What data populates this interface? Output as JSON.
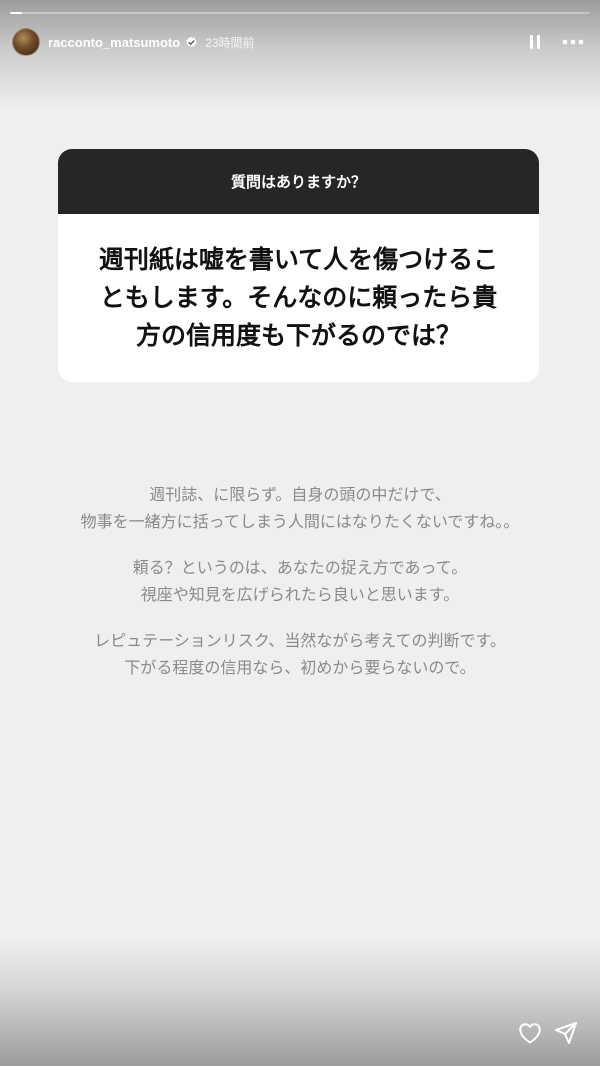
{
  "story": {
    "segments": 1,
    "progress": 0.02
  },
  "header": {
    "username": "racconto_matsumoto",
    "verified": true,
    "timestamp": "23時間前",
    "avatar_icon": "profile-avatar",
    "pause_icon": "pause-icon",
    "more_icon": "more-horizontal-icon"
  },
  "question_sticker": {
    "prompt": "質問はありますか？",
    "question_lines": [
      "週刊紙は嘘を書いて人を傷つけるこ",
      "ともします。そんなのに頼ったら貴",
      "方の信用度も下がるのでは？"
    ]
  },
  "answer": {
    "paragraphs": [
      [
        "週刊誌、に限らず。自身の頭の中だけで、",
        "物事を一緒方に括ってしまう人間にはなりたくないですね。。"
      ],
      [
        "頼る？というのは、あなたの捉え方であって。",
        "視座や知見を広げられたら良いと思います。"
      ],
      [
        "レピュテーションリスク、当然ながら考えての判断です。",
        "下がる程度の信用なら、初めから要らないので。"
      ]
    ]
  },
  "footer": {
    "like_icon": "heart-icon",
    "share_icon": "send-icon"
  },
  "colors": {
    "background": "#efefef",
    "sticker_header": "#262626",
    "sticker_body": "#ffffff",
    "answer_text": "#8a8a8a"
  }
}
